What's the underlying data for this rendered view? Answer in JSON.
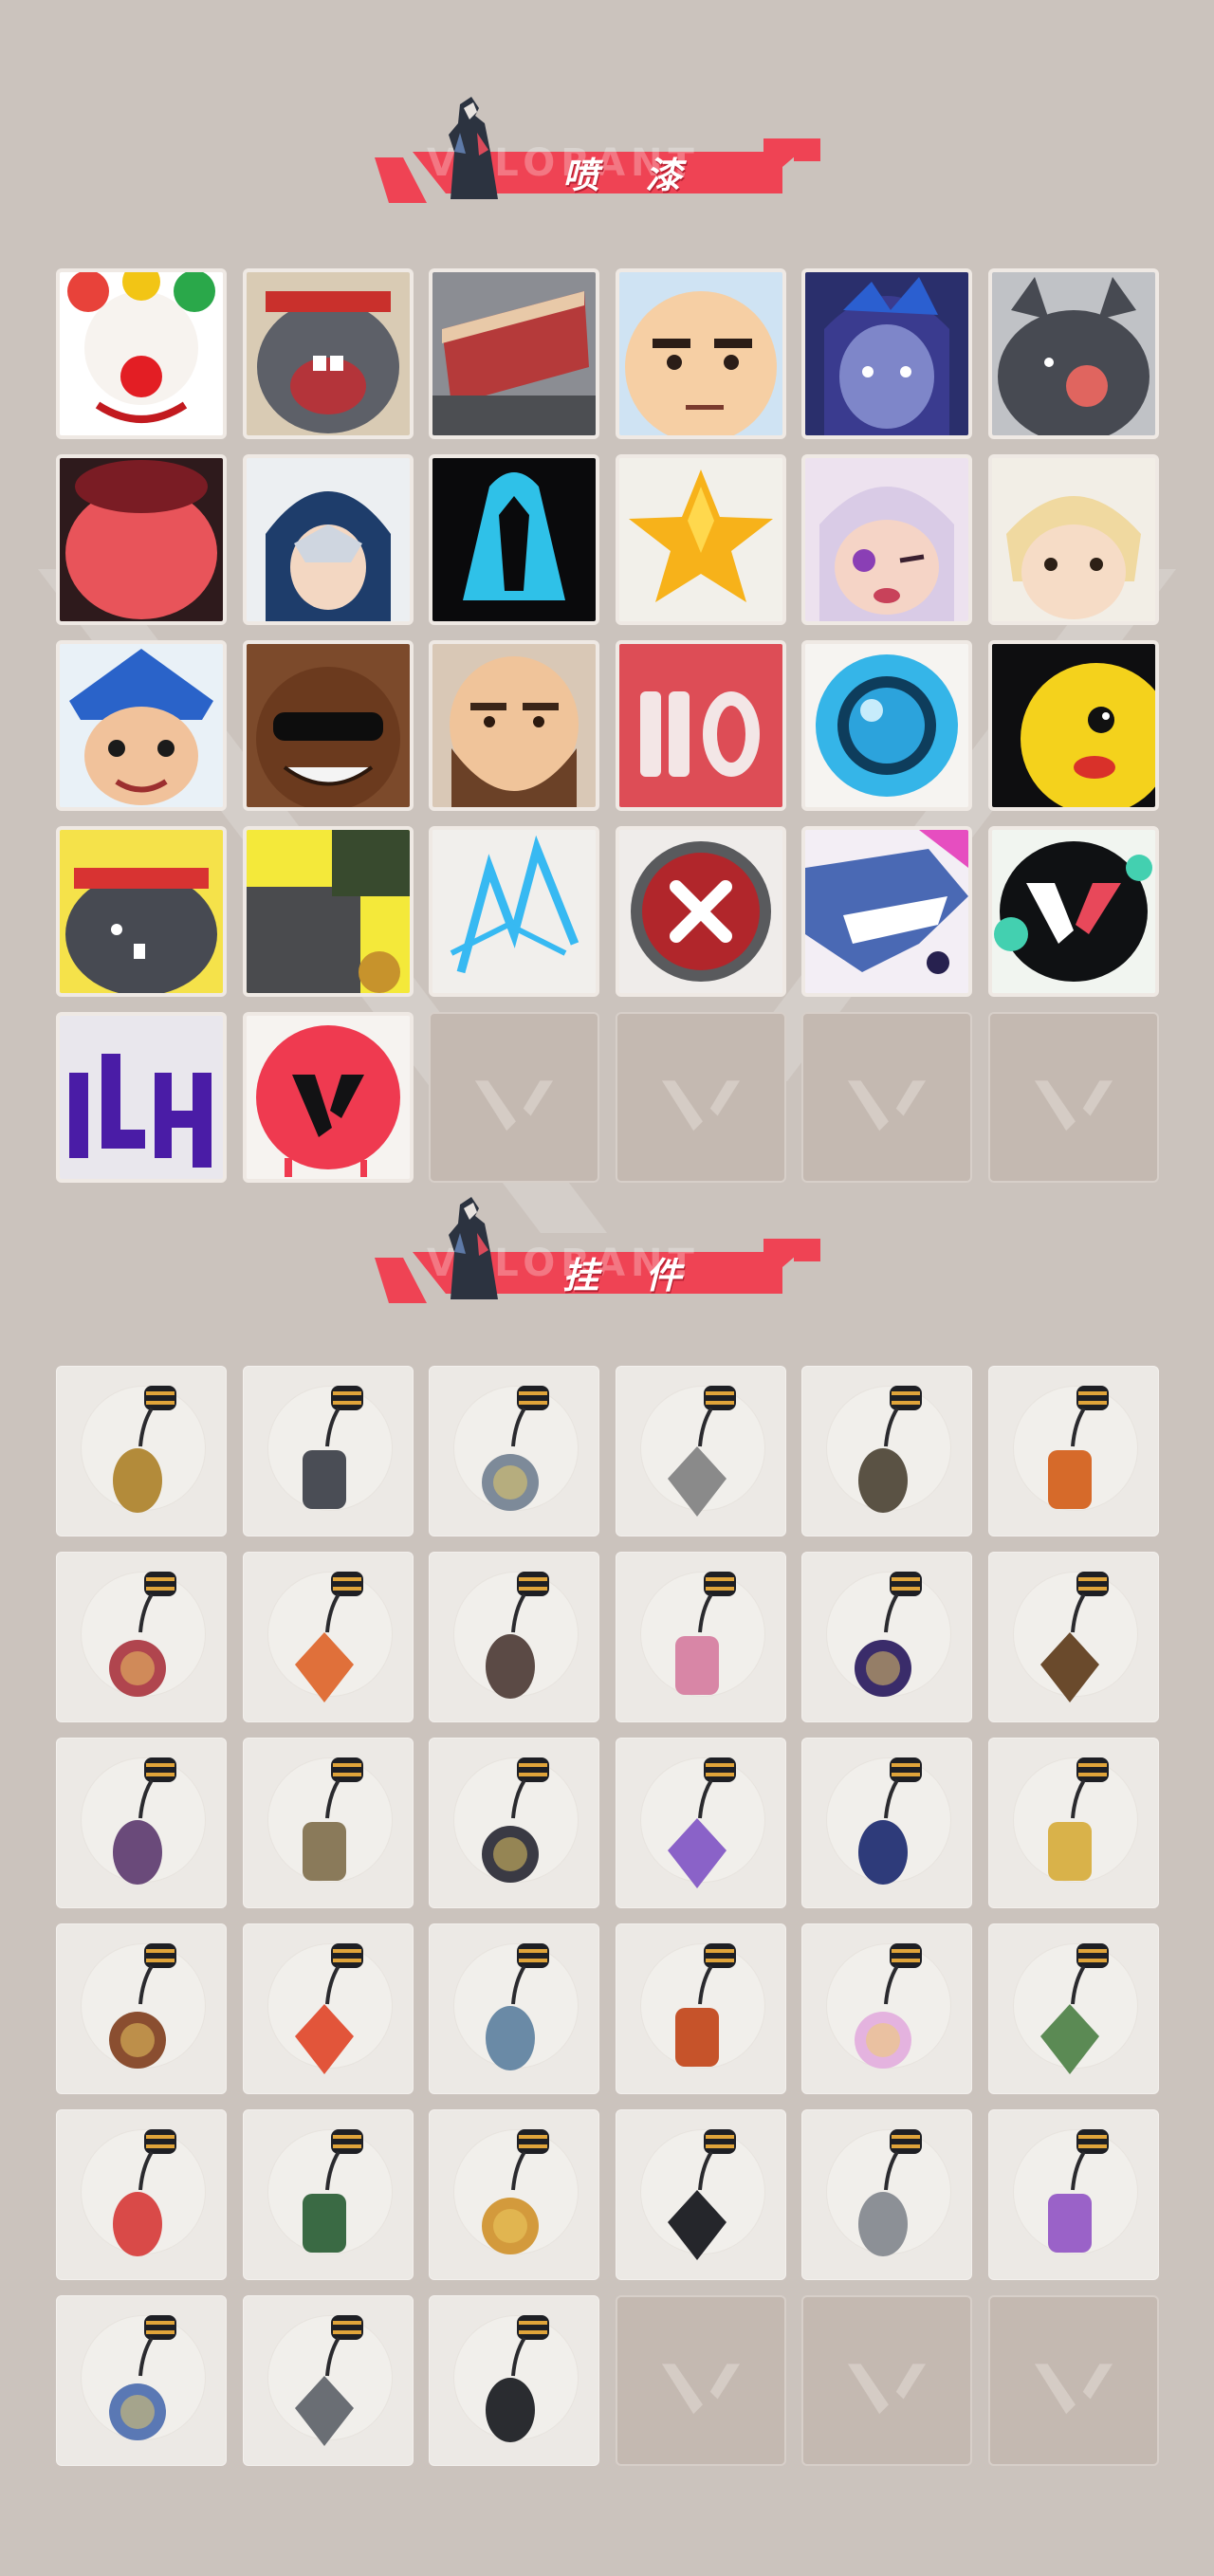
{
  "sections": {
    "sprays": {
      "title": "喷 漆",
      "ghost_text": "VALORANT",
      "items": [
        "clown-spray",
        "screaming-blob-spray",
        "cake-slice-spray",
        "smug-face-spray",
        "hooded-agent-spray",
        "laughing-blob-spray",
        "open-mouth-spray",
        "hooded-girl-spray",
        "blue-mask-spray",
        "gold-star-spray",
        "winking-girl-spray",
        "blonde-agent-spray",
        "bandana-girl-spray",
        "sunglasses-agent-spray",
        "bearded-agent-spray",
        "number-110-spray",
        "blue-orb-spray",
        "yellow-critter-spray",
        "headband-blob-spray",
        "cannon-spray",
        "neon-star-spray",
        "red-x-button-spray",
        "shark-spray",
        "valorant-splat-spray",
        "graffiti-tag-spray",
        "red-valorant-logo-spray"
      ],
      "empty_slots": 4
    },
    "charms": {
      "title": "挂 件",
      "ghost_text": "VALORANT",
      "items": [
        "gold-cat-charm",
        "robot-drone-charm",
        "bathtub-charm",
        "astronaut-cat-charm",
        "round-pouch-charm",
        "blue-canister-charm",
        "chainsaw-sword-charm",
        "flame-chili-charm",
        "braided-rope-charm",
        "cupcake-charm",
        "ep7-badge-charm-pink",
        "wooden-crossbow-charm",
        "agent-figure-charm",
        "cowboy-figure-charm",
        "dark-creature-charm",
        "lava-lamp-charm",
        "ep7-badge-charm-blue",
        "banana-pod-charm",
        "chocolate-bar-charm",
        "fruit-skewer-charm",
        "agent-acrylic-charm",
        "hot-air-balloon-charm",
        "pink-hair-charm",
        "green-robot-charm",
        "watermelon-charm",
        "soda-can-charm",
        "beehive-charm",
        "ep7-badge-charm-gold",
        "silver-shell-charm",
        "lotus-flame-charm",
        "ufo-charm",
        "grey-cat-charm",
        "valorant-dogtag-charm"
      ],
      "empty_slots": 3
    }
  },
  "colors": {
    "background": "#cbc3bd",
    "banner_red": "#ef4354",
    "tile_light": "#f4f1ed",
    "empty_tile": "#c4b9b1"
  }
}
